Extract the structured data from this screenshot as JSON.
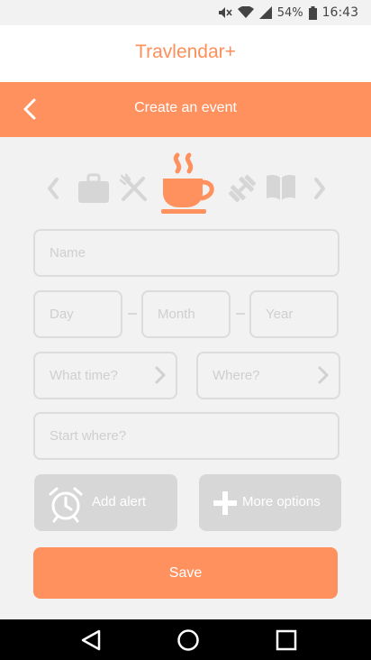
{
  "status_bar": {
    "battery": "54%",
    "time": "16:43",
    "icons": [
      "mute-icon",
      "wifi-icon",
      "cell-signal-icon",
      "battery-icon"
    ]
  },
  "app": {
    "title": "Travlendar+"
  },
  "header": {
    "title": "Create an event",
    "back_icon": "chevron-left-icon"
  },
  "category_carousel": {
    "icons": [
      "prev-arrow-icon",
      "briefcase-icon",
      "utensils-icon",
      "coffee-cup-icon",
      "dumbbell-icon",
      "book-icon",
      "next-arrow-icon"
    ],
    "selected": "coffee-cup-icon"
  },
  "form": {
    "name_placeholder": "Name",
    "day_placeholder": "Day",
    "month_placeholder": "Month",
    "year_placeholder": "Year",
    "time_placeholder": "What time?",
    "where_placeholder": "Where?",
    "start_placeholder": "Start where?"
  },
  "buttons": {
    "add_alert": "Add alert",
    "more_options": "More options",
    "save": "Save"
  },
  "colors": {
    "accent": "#ff915f",
    "background": "#f2f2f2",
    "border": "#dcdcdc",
    "disabled": "#d7d7d7"
  }
}
